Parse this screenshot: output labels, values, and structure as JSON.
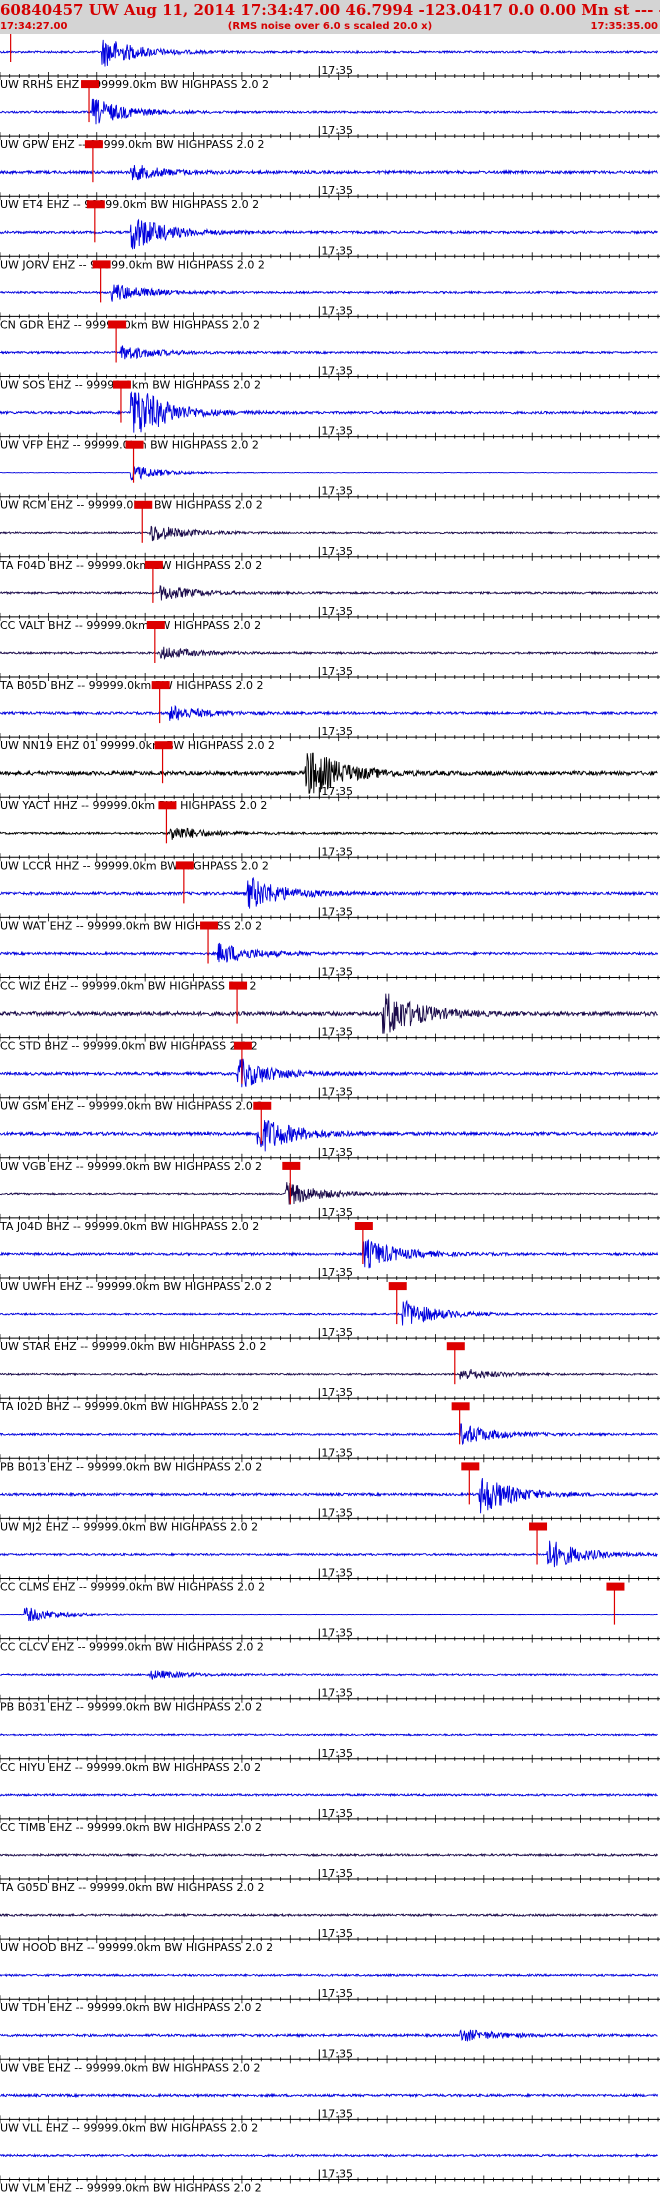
{
  "header": {
    "title": "60840457 UW Aug 11, 2014 17:34:47.00   46.7994 -123.0417  0.0 0.00 Mn st --- -- --  -1",
    "start_time": "17:34:27.00",
    "noise_note": "(RMS noise over 6.0 s scaled 20.0 x)",
    "end_time": "17:35:35.00"
  },
  "chart_data": {
    "type": "seismogram",
    "time_start": "17:34:27.00",
    "time_end": "17:35:35.00",
    "time_range_s": [
      0,
      68
    ],
    "minute_tick_label": "17:35",
    "minute_tick_s": 33,
    "trace_color_default": "#0000dd",
    "trace_color_dark": "#1a0a4a",
    "trace_color_black": "#000000",
    "pick_color": "#dd0000",
    "traces": [
      {
        "label": "UW RRHS EHZ -- 99999.0km BW  HIGHPASS  2.0  2",
        "pick_s": 1.1,
        "color": "blue",
        "amp": 0.25,
        "burst_s": 11,
        "burst_amp": 1.0
      },
      {
        "label": "UW GPW EHZ -- 99999.0km BW  HIGHPASS  2.0  2",
        "pick_s": 9.2,
        "color": "blue",
        "amp": 0.25,
        "burst_s": 10,
        "burst_amp": 0.9
      },
      {
        "label": "UW ET4 EHZ -- 99999.0km BW  HIGHPASS  2.0  2",
        "pick_s": 9.6,
        "color": "blue",
        "amp": 0.35,
        "burst_s": 14,
        "burst_amp": 0.5
      },
      {
        "label": "UW JORV EHZ -- 99999.0km BW  HIGHPASS  2.0  2",
        "pick_s": 9.8,
        "color": "blue",
        "amp": 0.3,
        "burst_s": 14,
        "burst_amp": 1.2
      },
      {
        "label": "CN GDR EHZ -- 99999.0km BW  HIGHPASS  2.0  2",
        "pick_s": 10.4,
        "color": "blue",
        "amp": 0.25,
        "burst_s": 12,
        "burst_amp": 0.6
      },
      {
        "label": "UW SOS EHZ -- 99999.0km BW  HIGHPASS  2.0  2",
        "pick_s": 12.0,
        "color": "blue",
        "amp": 0.25,
        "burst_s": 13,
        "burst_amp": 0.5
      },
      {
        "label": "UW VFP EHZ -- 99999.0km BW  HIGHPASS  2.0  2",
        "pick_s": 12.5,
        "color": "blue",
        "amp": 0.3,
        "burst_s": 14,
        "burst_amp": 2.0
      },
      {
        "label": "UW RCM EHZ -- 99999.0km BW  HIGHPASS  2.0  2",
        "pick_s": 13.8,
        "color": "blue",
        "amp": 0.05,
        "burst_s": 14,
        "burst_amp": 0.5
      },
      {
        "label": "TA F04D BHZ -- 99999.0km BW  HIGHPASS  2.0  2",
        "pick_s": 14.7,
        "color": "dark",
        "amp": 0.2,
        "burst_s": 16,
        "burst_amp": 0.6
      },
      {
        "label": "CC VALT BHZ -- 99999.0km BW  HIGHPASS  2.0  2",
        "pick_s": 15.8,
        "color": "dark",
        "amp": 0.25,
        "burst_s": 17,
        "burst_amp": 0.5
      },
      {
        "label": "TA B05D BHZ -- 99999.0km BW  HIGHPASS  2.0  2",
        "pick_s": 16.0,
        "color": "dark",
        "amp": 0.25,
        "burst_s": 17,
        "burst_amp": 0.4
      },
      {
        "label": "UW NN19 EHZ 01 99999.0km BW  HIGHPASS  2.0  2",
        "pick_s": 16.5,
        "color": "blue",
        "amp": 0.3,
        "burst_s": 18,
        "burst_amp": 0.5
      },
      {
        "label": "UW YACT HHZ -- 99999.0km BW  HIGHPASS  2.0  2",
        "pick_s": 16.8,
        "color": "black",
        "amp": 0.5,
        "burst_s": 32,
        "burst_amp": 1.8
      },
      {
        "label": "UW LCCR HHZ -- 99999.0km BW  HIGHPASS  2.0  2",
        "pick_s": 17.2,
        "color": "black",
        "amp": 0.25,
        "burst_s": 18,
        "burst_amp": 0.5
      },
      {
        "label": "UW WAT EHZ -- 99999.0km BW  HIGHPASS  2.0  2",
        "pick_s": 19.0,
        "color": "blue",
        "amp": 0.35,
        "burst_s": 26,
        "burst_amp": 1.1
      },
      {
        "label": "CC WIZ EHZ -- 99999.0km BW  HIGHPASS  2.0  2",
        "pick_s": 21.5,
        "color": "blue",
        "amp": 0.3,
        "burst_s": 23,
        "burst_amp": 0.7
      },
      {
        "label": "CC STD BHZ -- 99999.0km BW  HIGHPASS  2.0  2",
        "pick_s": 24.5,
        "color": "dark",
        "amp": 0.5,
        "burst_s": 40,
        "burst_amp": 1.6
      },
      {
        "label": "UW GSM EHZ -- 99999.0km BW  HIGHPASS  2.0  2",
        "pick_s": 25.0,
        "color": "blue",
        "amp": 0.35,
        "burst_s": 25,
        "burst_amp": 1.0
      },
      {
        "label": "UW VGB EHZ -- 99999.0km BW  HIGHPASS  2.0  2",
        "pick_s": 27.0,
        "color": "blue",
        "amp": 0.4,
        "burst_s": 27,
        "burst_amp": 1.3
      },
      {
        "label": "TA J04D BHZ -- 99999.0km BW  HIGHPASS  2.0  2",
        "pick_s": 30.0,
        "color": "dark",
        "amp": 0.2,
        "burst_s": 30,
        "burst_amp": 0.8
      },
      {
        "label": "UW UWFH EHZ -- 99999.0km BW  HIGHPASS  2.0  2",
        "pick_s": 37.5,
        "color": "blue",
        "amp": 0.3,
        "burst_s": 38,
        "burst_amp": 1.0
      },
      {
        "label": "UW STAR EHZ -- 99999.0km BW  HIGHPASS  2.0  2",
        "pick_s": 41.0,
        "color": "blue",
        "amp": 0.2,
        "burst_s": 42,
        "burst_amp": 0.9
      },
      {
        "label": "TA I02D BHZ -- 99999.0km BW  HIGHPASS  2.0  2",
        "pick_s": 47.0,
        "color": "dark",
        "amp": 0.2,
        "burst_s": 48,
        "burst_amp": 0.4
      },
      {
        "label": "PB B013 EHZ -- 99999.0km BW  HIGHPASS  2.0  2",
        "pick_s": 47.5,
        "color": "blue",
        "amp": 0.25,
        "burst_s": 48,
        "burst_amp": 0.7
      },
      {
        "label": "UW MJ2 EHZ -- 99999.0km BW  HIGHPASS  2.0  2",
        "pick_s": 48.5,
        "color": "blue",
        "amp": 0.3,
        "burst_s": 50,
        "burst_amp": 1.3
      },
      {
        "label": "CC CLMS EHZ -- 99999.0km BW  HIGHPASS  2.0  2",
        "pick_s": 55.5,
        "color": "blue",
        "amp": 0.25,
        "burst_s": 57,
        "burst_amp": 1.0
      },
      {
        "label": "CC CLCV EHZ -- 99999.0km BW  HIGHPASS  2.0  2",
        "pick_s": 63.5,
        "color": "blue",
        "amp": 0.05,
        "burst_s": 3,
        "burst_amp": 0.5
      },
      {
        "label": "PB B031 EHZ -- 99999.0km BW  HIGHPASS  2.0  2",
        "pick_s": null,
        "color": "blue",
        "amp": 0.2,
        "burst_s": 16,
        "burst_amp": 0.3
      },
      {
        "label": "CC HIYU EHZ -- 99999.0km BW  HIGHPASS  2.0  2",
        "pick_s": null,
        "color": "blue",
        "amp": 0.2,
        "burst_s": null,
        "burst_amp": 0
      },
      {
        "label": "CC TIMB EHZ -- 99999.0km BW  HIGHPASS  2.0  2",
        "pick_s": null,
        "color": "blue",
        "amp": 0.25,
        "burst_s": null,
        "burst_amp": 0
      },
      {
        "label": "TA G05D BHZ -- 99999.0km BW  HIGHPASS  2.0  2",
        "pick_s": null,
        "color": "dark",
        "amp": 0.25,
        "burst_s": null,
        "burst_amp": 0
      },
      {
        "label": "UW HOOD BHZ -- 99999.0km BW  HIGHPASS  2.0  2",
        "pick_s": null,
        "color": "dark",
        "amp": 0.25,
        "burst_s": null,
        "burst_amp": 0
      },
      {
        "label": "UW TDH EHZ -- 99999.0km BW  HIGHPASS  2.0  2",
        "pick_s": null,
        "color": "blue",
        "amp": 0.25,
        "burst_s": null,
        "burst_amp": 0
      },
      {
        "label": "UW VBE EHZ -- 99999.0km BW  HIGHPASS  2.0  2",
        "pick_s": null,
        "color": "blue",
        "amp": 0.3,
        "burst_s": 48,
        "burst_amp": 0.4
      },
      {
        "label": "UW VLL EHZ -- 99999.0km BW  HIGHPASS  2.0  2",
        "pick_s": null,
        "color": "blue",
        "amp": 0.3,
        "burst_s": null,
        "burst_amp": 0
      },
      {
        "label": "UW VLM EHZ -- 99999.0km BW  HIGHPASS  2.0  2",
        "pick_s": null,
        "color": "blue",
        "amp": 0.25,
        "burst_s": null,
        "burst_amp": 0
      }
    ]
  }
}
